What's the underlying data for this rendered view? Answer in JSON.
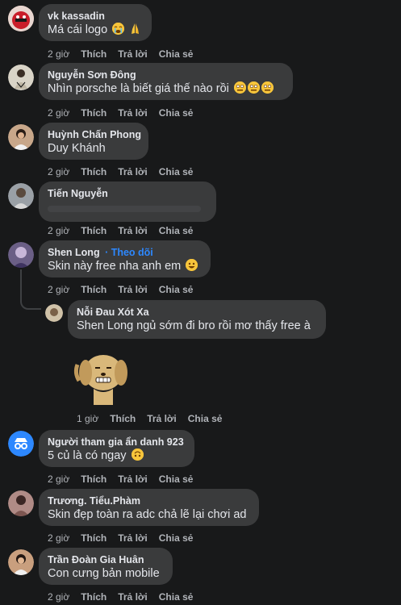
{
  "comments": [
    {
      "author": "vk kassadin",
      "text": "Má cái logo",
      "time": "2 giờ",
      "like": "Thích",
      "reply": "Trả lời",
      "share": "Chia sẻ",
      "emojis": [
        "cry-face-icon",
        "pray-hands-icon"
      ]
    },
    {
      "author": "Nguyễn Sơn Đông",
      "text": "Nhìn porsche là biết giá thế nào rồi",
      "time": "2 giờ",
      "like": "Thích",
      "reply": "Trả lời",
      "share": "Chia sẻ",
      "emojis": [
        "dizzy-face-icon",
        "dizzy-face-icon",
        "dizzy-face-icon"
      ]
    },
    {
      "author": "Huỳnh Chấn Phong",
      "text": "Duy Khánh",
      "time": "2 giờ",
      "like": "Thích",
      "reply": "Trả lời",
      "share": "Chia sẻ"
    },
    {
      "author": "Tiến Nguyễn",
      "text": "",
      "time": "2 giờ",
      "like": "Thích",
      "reply": "Trả lời",
      "share": "Chia sẻ"
    },
    {
      "author": "Shen Long",
      "follow": "Theo dõi",
      "text": "Skin này free nha anh em",
      "time": "2 giờ",
      "like": "Thích",
      "reply": "Trả lời",
      "share": "Chia sẻ",
      "emojis": [
        "grin-face-icon"
      ]
    },
    {
      "author": "Người tham gia ẩn danh 923",
      "text": "5 củ là có ngay",
      "time": "2 giờ",
      "like": "Thích",
      "reply": "Trả lời",
      "share": "Chia sẻ",
      "emojis": [
        "upside-down-face-icon"
      ]
    },
    {
      "author": "Trương. Tiểu.Phàm",
      "text": "Skin đẹp toàn ra adc chả lẽ lại chơi ad",
      "time": "2 giờ",
      "like": "Thích",
      "reply": "Trả lời",
      "share": "Chia sẻ"
    },
    {
      "author": "Trần Đoàn Gia Huân",
      "text": "Con cưng bản mobile",
      "time": "2 giờ",
      "like": "Thích",
      "reply": "Trả lời",
      "share": "Chia sẻ"
    }
  ],
  "reply": {
    "author": "Nỗi Đau Xót Xa",
    "text": "Shen Long ngủ sớm đi bro rồi mơ thấy free à",
    "time": "1 giờ",
    "like": "Thích",
    "reply": "Trả lời",
    "share": "Chia sẻ",
    "sticker": "dog-grin-sticker-icon"
  },
  "colors": {
    "background": "#18191a",
    "bubble": "#3a3b3c",
    "link": "#2d88ff",
    "meta": "#b0b3b8"
  }
}
